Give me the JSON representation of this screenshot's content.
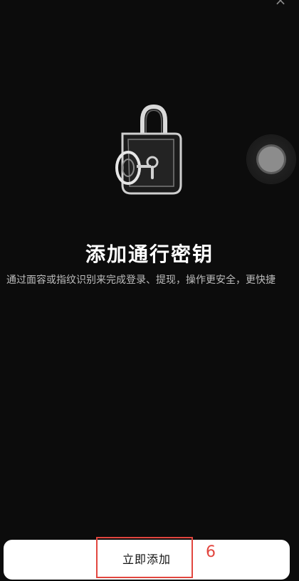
{
  "close": {
    "icon": "close-icon",
    "glyph": "×"
  },
  "hero": {
    "icon": "padlock-key-icon"
  },
  "floating_ball": {
    "icon": "assistive-touch-icon"
  },
  "main": {
    "title": "添加通行密钥",
    "description": "通过面容或指纹识别来完成登录、提现，操作更安全，更快捷"
  },
  "footer": {
    "add_now_label": "立即添加"
  },
  "annotation": {
    "step_number": "6",
    "color": "#e2463f"
  }
}
